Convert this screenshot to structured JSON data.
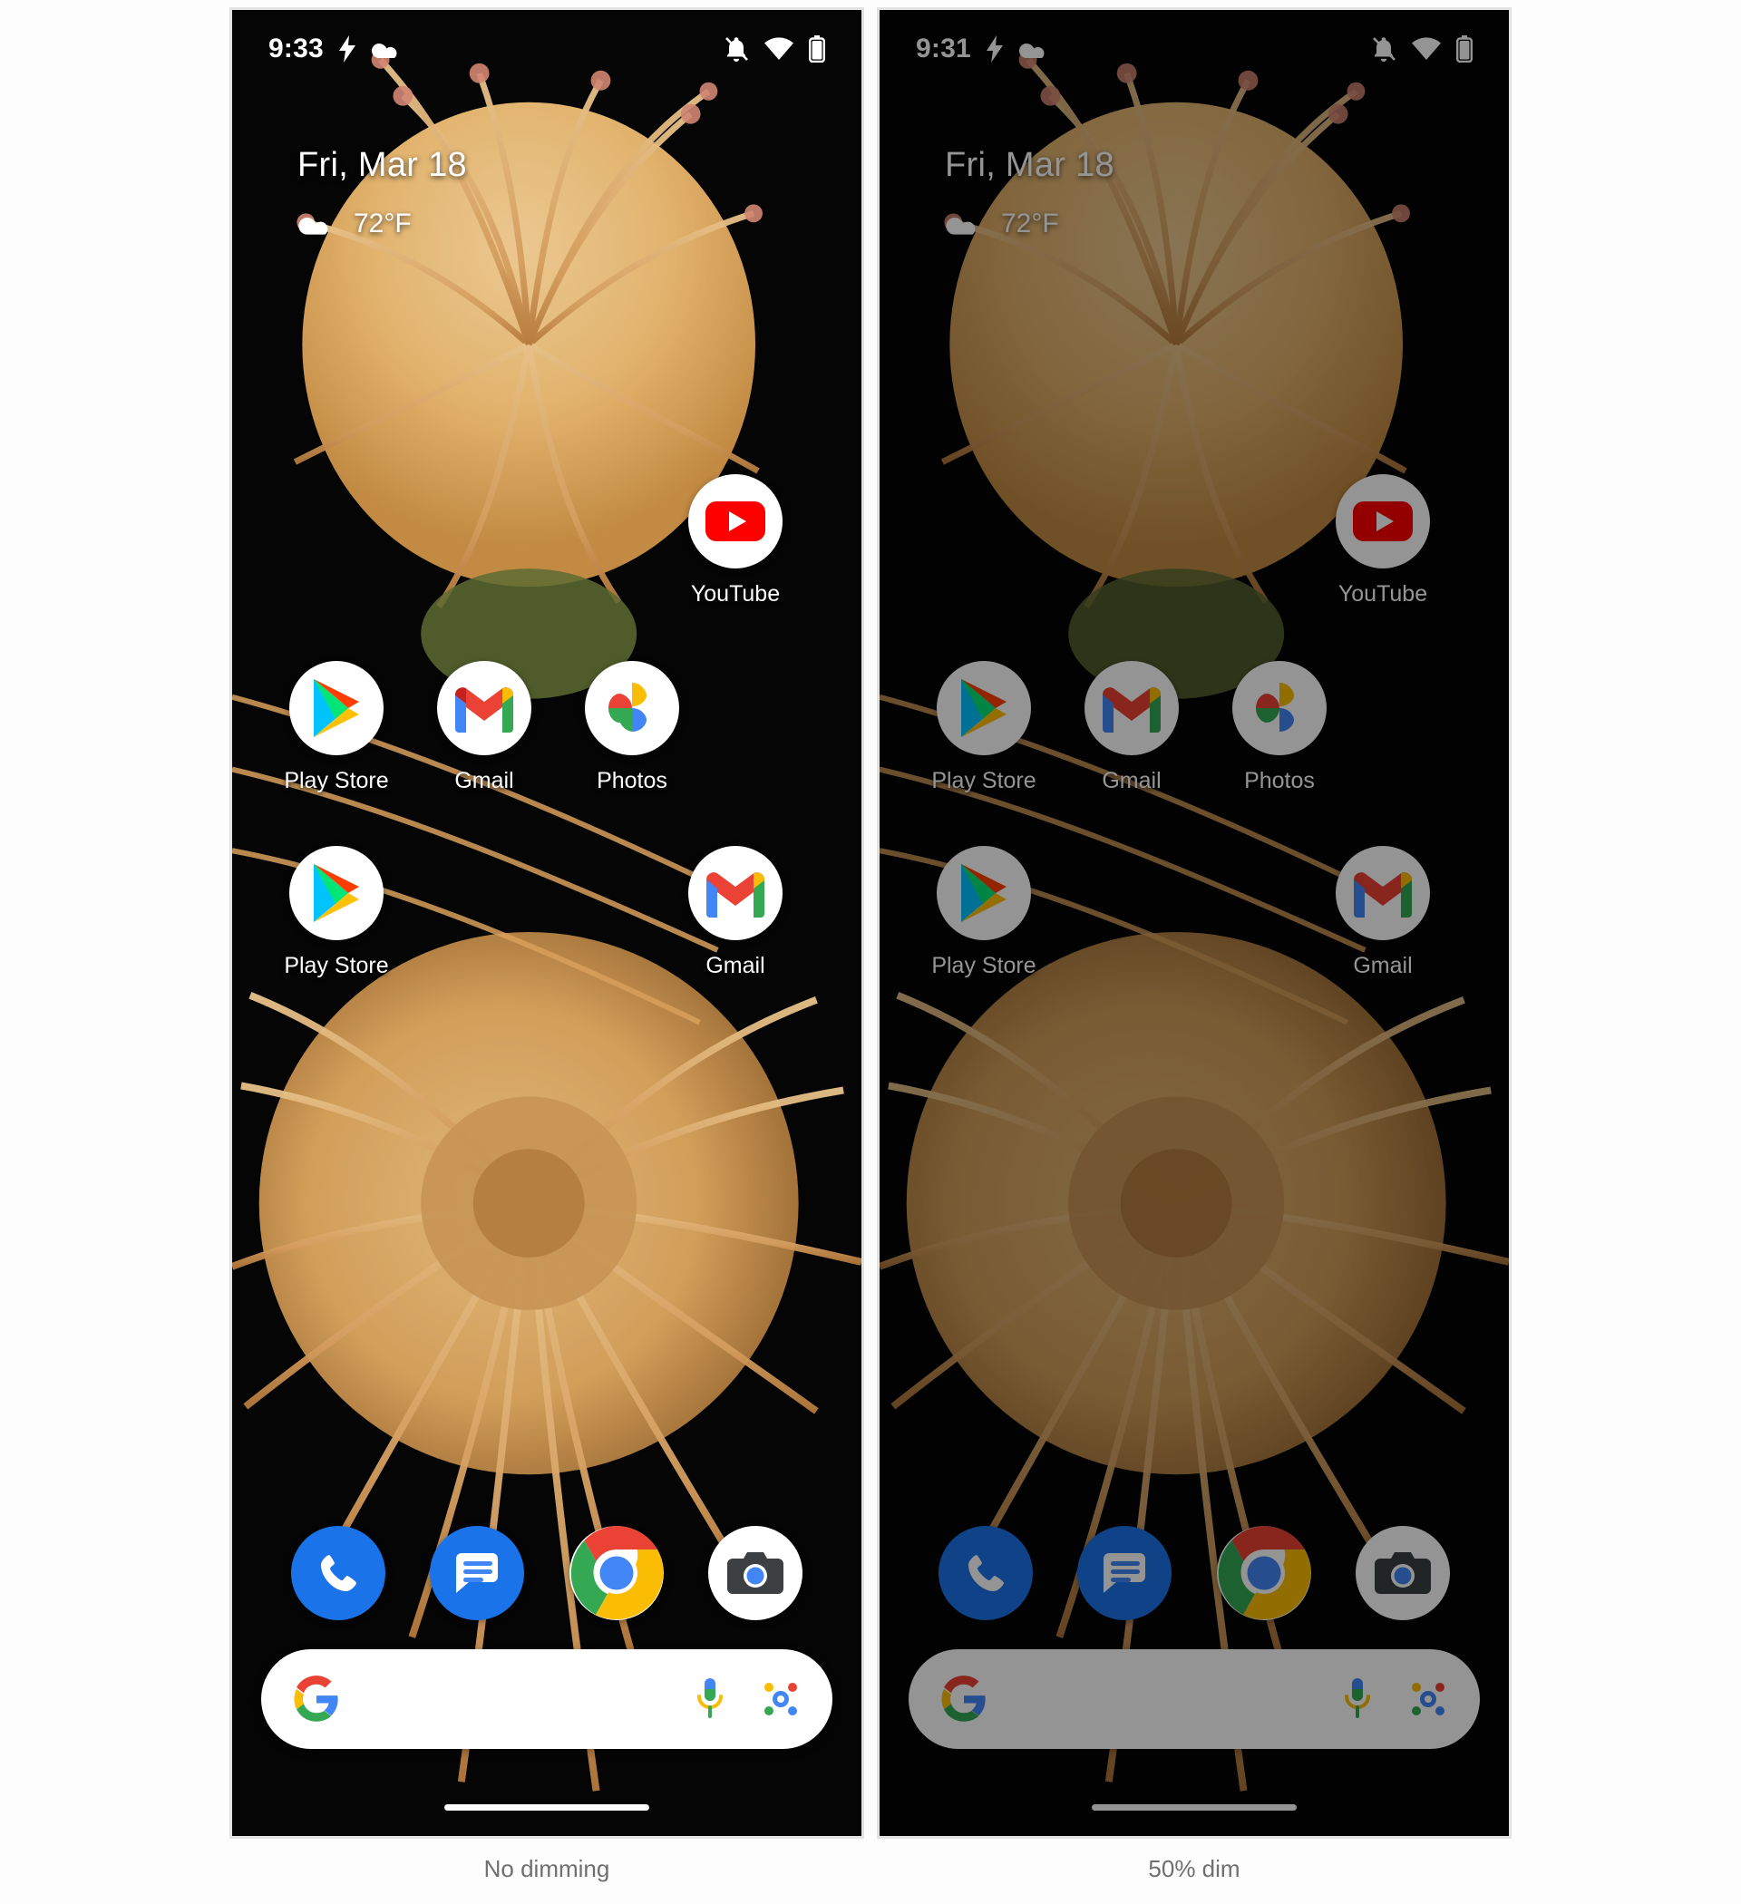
{
  "comparison": {
    "panels": [
      {
        "caption": "No dimming",
        "dim_level": 0,
        "status_bar": {
          "time": "9:33",
          "left_icons": [
            "bolt-icon",
            "cloud-icon"
          ],
          "right_icons": [
            "notifications-off-icon",
            "wifi-icon",
            "battery-icon"
          ]
        },
        "widget": {
          "date": "Fri, Mar 18",
          "weather_icon": "cloud-icon",
          "temperature": "72°F"
        },
        "apps": [
          {
            "label": "YouTube",
            "icon": "youtube-icon",
            "col": 3,
            "row": 0
          },
          {
            "label": "Play Store",
            "icon": "play-store-icon",
            "col": 0,
            "row": 1
          },
          {
            "label": "Gmail",
            "icon": "gmail-icon",
            "col": 1,
            "row": 1
          },
          {
            "label": "Photos",
            "icon": "photos-icon",
            "col": 2,
            "row": 1
          },
          {
            "label": "Play Store",
            "icon": "play-store-icon",
            "col": 0,
            "row": 2
          },
          {
            "label": "Gmail",
            "icon": "gmail-icon",
            "col": 3,
            "row": 2
          }
        ],
        "dock": [
          {
            "name": "Phone",
            "icon": "phone-icon"
          },
          {
            "name": "Messages",
            "icon": "messages-icon"
          },
          {
            "name": "Chrome",
            "icon": "chrome-icon"
          },
          {
            "name": "Camera",
            "icon": "camera-icon"
          }
        ],
        "search": {
          "logo": "google-g-icon",
          "placeholder": "",
          "value": "",
          "mic": "microphone-icon",
          "lens": "google-lens-icon"
        }
      },
      {
        "caption": "50% dim",
        "dim_level": 50,
        "status_bar": {
          "time": "9:31",
          "left_icons": [
            "bolt-icon",
            "cloud-icon"
          ],
          "right_icons": [
            "notifications-off-icon",
            "wifi-icon",
            "battery-icon"
          ]
        },
        "widget": {
          "date": "Fri, Mar 18",
          "weather_icon": "cloud-icon",
          "temperature": "72°F"
        },
        "apps": [
          {
            "label": "YouTube",
            "icon": "youtube-icon",
            "col": 3,
            "row": 0
          },
          {
            "label": "Play Store",
            "icon": "play-store-icon",
            "col": 0,
            "row": 1
          },
          {
            "label": "Gmail",
            "icon": "gmail-icon",
            "col": 1,
            "row": 1
          },
          {
            "label": "Photos",
            "icon": "photos-icon",
            "col": 2,
            "row": 1
          },
          {
            "label": "Play Store",
            "icon": "play-store-icon",
            "col": 0,
            "row": 2
          },
          {
            "label": "Gmail",
            "icon": "gmail-icon",
            "col": 3,
            "row": 2
          }
        ],
        "dock": [
          {
            "name": "Phone",
            "icon": "phone-icon"
          },
          {
            "name": "Messages",
            "icon": "messages-icon"
          },
          {
            "name": "Chrome",
            "icon": "chrome-icon"
          },
          {
            "name": "Camera",
            "icon": "camera-icon"
          }
        ],
        "search": {
          "logo": "google-g-icon",
          "placeholder": "",
          "value": "",
          "mic": "microphone-icon",
          "lens": "google-lens-icon"
        }
      }
    ]
  },
  "colors": {
    "google_blue": "#4285F4",
    "google_red": "#EA4335",
    "google_yellow": "#FBBC04",
    "google_green": "#34A853",
    "youtube_red": "#FF0000",
    "dock_blue": "#1A73E8",
    "caption_gray": "#6F6F6F",
    "wallpaper_bg": "#050505",
    "petal_orange": "#E8A254"
  },
  "wallpaper": {
    "subject": "pincushion-protea-flower",
    "background": "black"
  }
}
